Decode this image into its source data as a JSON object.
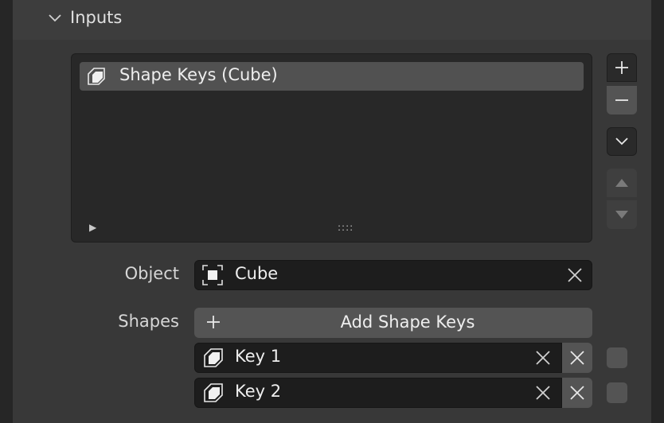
{
  "panel": {
    "title": "Inputs"
  },
  "list": {
    "items": [
      {
        "label": "Shape Keys (Cube)",
        "icon": "shape-key-icon",
        "selected": true
      }
    ],
    "grip": "::::"
  },
  "side_buttons": {
    "add_icon": "plus-icon",
    "remove_icon": "minus-icon",
    "menu_icon": "chevron-down-icon",
    "up_icon": "triangle-up-icon",
    "down_icon": "triangle-down-icon"
  },
  "object_field": {
    "label": "Object",
    "value": "Cube",
    "icon": "object-icon"
  },
  "shapes": {
    "label": "Shapes",
    "add_label": "Add Shape Keys",
    "keys": [
      {
        "value": "Key 1",
        "checked": false
      },
      {
        "value": "Key 2",
        "checked": false
      }
    ]
  },
  "colors": {
    "panel": "#383838",
    "field": "#1d1d1d",
    "button": "#545454",
    "selected_item": "#515151"
  }
}
